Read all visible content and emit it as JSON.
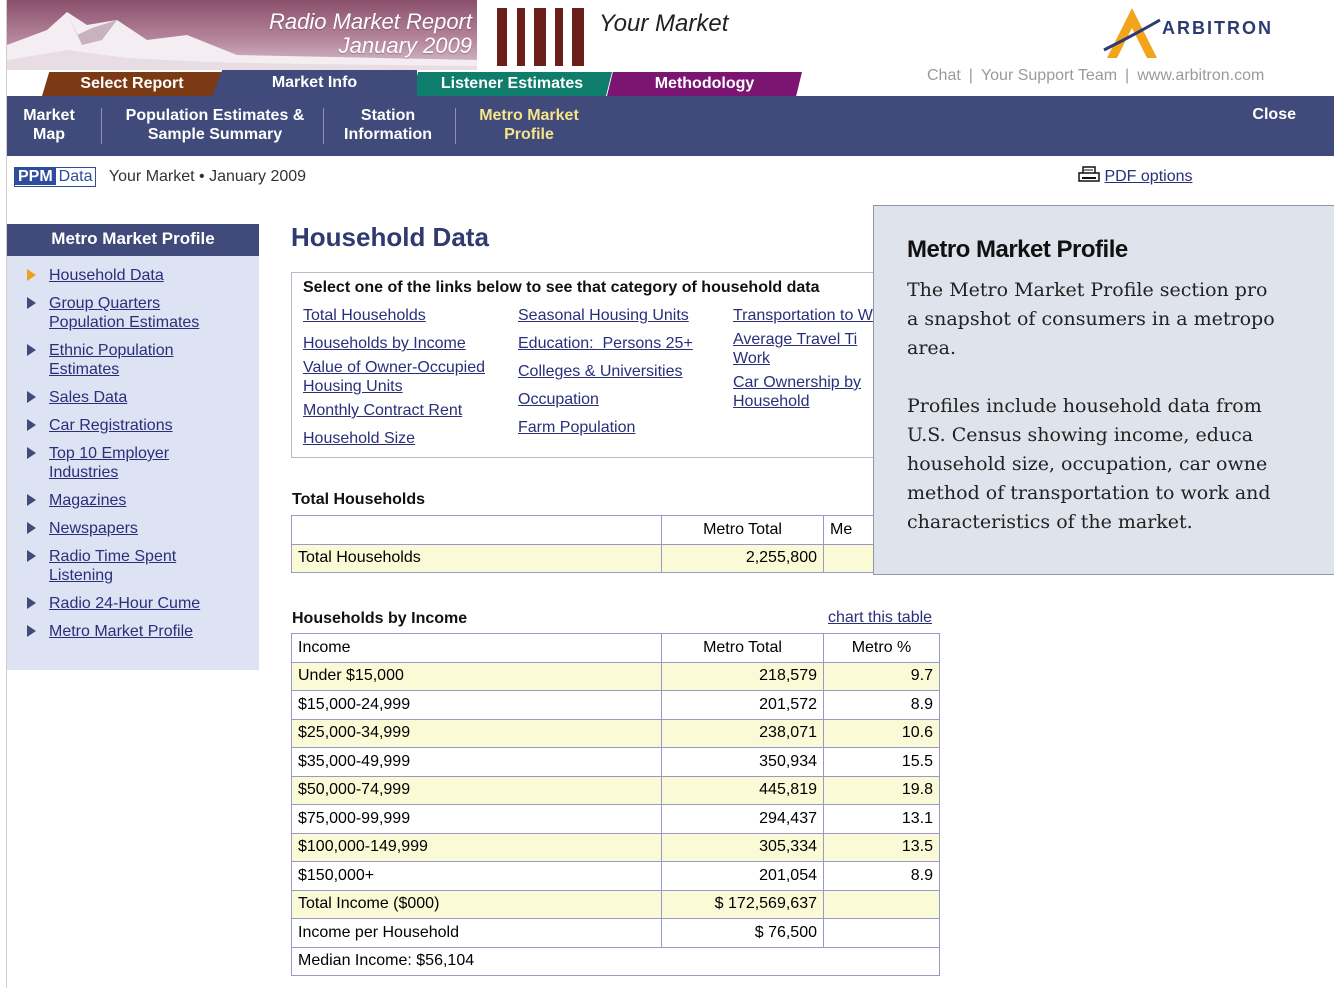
{
  "header": {
    "report_title_line1": "Radio Market Report",
    "report_title_line2": "January 2009",
    "market_name": "Your Market",
    "logo_text": "ARBITRON",
    "support_links": [
      "Chat",
      "Your Support Team",
      "www.arbitron.com"
    ],
    "tabs": [
      "Select Report",
      "Market Info",
      "Listener Estimates",
      "Methodology"
    ]
  },
  "nav": {
    "items": [
      "Market\nMap",
      "Population Estimates &\nSample Summary",
      "Station\nInformation",
      "Metro Market\nProfile"
    ],
    "close": "Close",
    "accent_color": "#404a7b"
  },
  "subheader": {
    "ppm_part1": "PPM",
    "ppm_part2": "Data",
    "text": "Your Market • January 2009",
    "pdf_label": "PDF options"
  },
  "sidebar": {
    "title": "Metro Market Profile",
    "items": [
      {
        "label": "Household Data",
        "current": true
      },
      {
        "label": "Group Quarters Population Estimates"
      },
      {
        "label": "Ethnic Population Estimates"
      },
      {
        "label": "Sales Data"
      },
      {
        "label": "Car Registrations"
      },
      {
        "label": "Top 10 Employer Industries"
      },
      {
        "label": "Magazines"
      },
      {
        "label": "Newspapers"
      },
      {
        "label": "Radio Time Spent Listening"
      },
      {
        "label": "Radio 24-Hour Cume"
      },
      {
        "label": "Metro Market Profile"
      }
    ]
  },
  "main": {
    "title": "Household Data",
    "linkbox_heading": "Select one of the links below to see that category of household data",
    "link_cols": [
      [
        "Total Households",
        "Households by Income",
        "Value of Owner-Occupied Housing Units",
        "Monthly Contract Rent",
        "Household Size"
      ],
      [
        "Seasonal Housing Units",
        "Education:  Persons 25+",
        "Colleges & Universities",
        "Occupation",
        "Farm Population"
      ],
      [
        "Transportation to W",
        "Average Travel Ti Work",
        "Car Ownership by Household"
      ]
    ],
    "total_households": {
      "title": "Total Households",
      "headers": [
        "",
        "Metro Total",
        "Me"
      ],
      "row": [
        "Total Households",
        "2,255,800",
        ""
      ]
    },
    "income": {
      "title": "Households by Income",
      "chart_link": "chart this table",
      "headers": [
        "Income",
        "Metro Total",
        "Metro %"
      ],
      "rows": [
        [
          "Under $15,000",
          "218,579",
          "9.7"
        ],
        [
          "$15,000-24,999",
          "201,572",
          "8.9"
        ],
        [
          "$25,000-34,999",
          "238,071",
          "10.6"
        ],
        [
          "$35,000-49,999",
          "350,934",
          "15.5"
        ],
        [
          "$50,000-74,999",
          "445,819",
          "19.8"
        ],
        [
          "$75,000-99,999",
          "294,437",
          "13.1"
        ],
        [
          "$100,000-149,999",
          "305,334",
          "13.5"
        ],
        [
          "$150,000+",
          "201,054",
          "8.9"
        ],
        [
          "Total Income ($000)",
          "$ 172,569,637",
          ""
        ],
        [
          "Income per Household",
          "$ 76,500",
          ""
        ]
      ],
      "median": "Median Income:  $56,104"
    }
  },
  "popup": {
    "title": "Metro Market Profile",
    "paragraph1": "The Metro Market Profile section pro\na snapshot of consumers in a metropo\narea.",
    "paragraph2": "Profiles include household data from\nU.S. Census showing  income, educa\nhousehold size, occupation, car owne\nmethod of transportation to work and\ncharacteristics of the market."
  }
}
